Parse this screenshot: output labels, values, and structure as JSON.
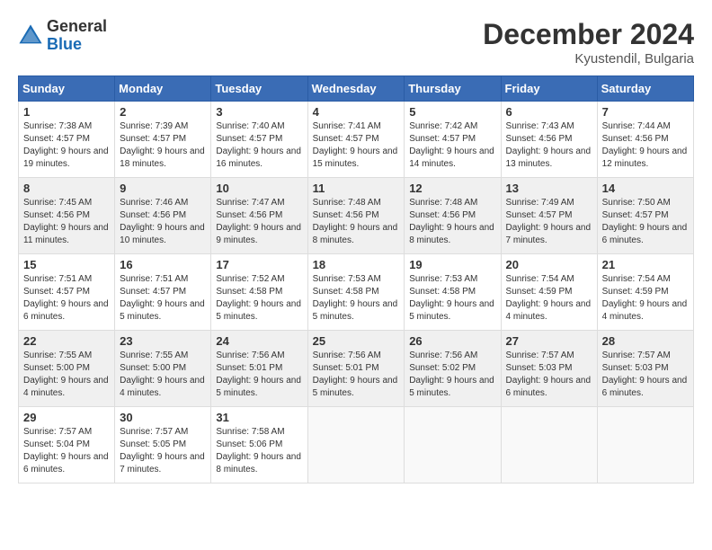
{
  "header": {
    "logo_general": "General",
    "logo_blue": "Blue",
    "month_year": "December 2024",
    "location": "Kyustendil, Bulgaria"
  },
  "weekdays": [
    "Sunday",
    "Monday",
    "Tuesday",
    "Wednesday",
    "Thursday",
    "Friday",
    "Saturday"
  ],
  "weeks": [
    [
      {
        "day": "1",
        "sunrise": "Sunrise: 7:38 AM",
        "sunset": "Sunset: 4:57 PM",
        "daylight": "Daylight: 9 hours and 19 minutes."
      },
      {
        "day": "2",
        "sunrise": "Sunrise: 7:39 AM",
        "sunset": "Sunset: 4:57 PM",
        "daylight": "Daylight: 9 hours and 18 minutes."
      },
      {
        "day": "3",
        "sunrise": "Sunrise: 7:40 AM",
        "sunset": "Sunset: 4:57 PM",
        "daylight": "Daylight: 9 hours and 16 minutes."
      },
      {
        "day": "4",
        "sunrise": "Sunrise: 7:41 AM",
        "sunset": "Sunset: 4:57 PM",
        "daylight": "Daylight: 9 hours and 15 minutes."
      },
      {
        "day": "5",
        "sunrise": "Sunrise: 7:42 AM",
        "sunset": "Sunset: 4:57 PM",
        "daylight": "Daylight: 9 hours and 14 minutes."
      },
      {
        "day": "6",
        "sunrise": "Sunrise: 7:43 AM",
        "sunset": "Sunset: 4:56 PM",
        "daylight": "Daylight: 9 hours and 13 minutes."
      },
      {
        "day": "7",
        "sunrise": "Sunrise: 7:44 AM",
        "sunset": "Sunset: 4:56 PM",
        "daylight": "Daylight: 9 hours and 12 minutes."
      }
    ],
    [
      {
        "day": "8",
        "sunrise": "Sunrise: 7:45 AM",
        "sunset": "Sunset: 4:56 PM",
        "daylight": "Daylight: 9 hours and 11 minutes."
      },
      {
        "day": "9",
        "sunrise": "Sunrise: 7:46 AM",
        "sunset": "Sunset: 4:56 PM",
        "daylight": "Daylight: 9 hours and 10 minutes."
      },
      {
        "day": "10",
        "sunrise": "Sunrise: 7:47 AM",
        "sunset": "Sunset: 4:56 PM",
        "daylight": "Daylight: 9 hours and 9 minutes."
      },
      {
        "day": "11",
        "sunrise": "Sunrise: 7:48 AM",
        "sunset": "Sunset: 4:56 PM",
        "daylight": "Daylight: 9 hours and 8 minutes."
      },
      {
        "day": "12",
        "sunrise": "Sunrise: 7:48 AM",
        "sunset": "Sunset: 4:56 PM",
        "daylight": "Daylight: 9 hours and 8 minutes."
      },
      {
        "day": "13",
        "sunrise": "Sunrise: 7:49 AM",
        "sunset": "Sunset: 4:57 PM",
        "daylight": "Daylight: 9 hours and 7 minutes."
      },
      {
        "day": "14",
        "sunrise": "Sunrise: 7:50 AM",
        "sunset": "Sunset: 4:57 PM",
        "daylight": "Daylight: 9 hours and 6 minutes."
      }
    ],
    [
      {
        "day": "15",
        "sunrise": "Sunrise: 7:51 AM",
        "sunset": "Sunset: 4:57 PM",
        "daylight": "Daylight: 9 hours and 6 minutes."
      },
      {
        "day": "16",
        "sunrise": "Sunrise: 7:51 AM",
        "sunset": "Sunset: 4:57 PM",
        "daylight": "Daylight: 9 hours and 5 minutes."
      },
      {
        "day": "17",
        "sunrise": "Sunrise: 7:52 AM",
        "sunset": "Sunset: 4:58 PM",
        "daylight": "Daylight: 9 hours and 5 minutes."
      },
      {
        "day": "18",
        "sunrise": "Sunrise: 7:53 AM",
        "sunset": "Sunset: 4:58 PM",
        "daylight": "Daylight: 9 hours and 5 minutes."
      },
      {
        "day": "19",
        "sunrise": "Sunrise: 7:53 AM",
        "sunset": "Sunset: 4:58 PM",
        "daylight": "Daylight: 9 hours and 5 minutes."
      },
      {
        "day": "20",
        "sunrise": "Sunrise: 7:54 AM",
        "sunset": "Sunset: 4:59 PM",
        "daylight": "Daylight: 9 hours and 4 minutes."
      },
      {
        "day": "21",
        "sunrise": "Sunrise: 7:54 AM",
        "sunset": "Sunset: 4:59 PM",
        "daylight": "Daylight: 9 hours and 4 minutes."
      }
    ],
    [
      {
        "day": "22",
        "sunrise": "Sunrise: 7:55 AM",
        "sunset": "Sunset: 5:00 PM",
        "daylight": "Daylight: 9 hours and 4 minutes."
      },
      {
        "day": "23",
        "sunrise": "Sunrise: 7:55 AM",
        "sunset": "Sunset: 5:00 PM",
        "daylight": "Daylight: 9 hours and 4 minutes."
      },
      {
        "day": "24",
        "sunrise": "Sunrise: 7:56 AM",
        "sunset": "Sunset: 5:01 PM",
        "daylight": "Daylight: 9 hours and 5 minutes."
      },
      {
        "day": "25",
        "sunrise": "Sunrise: 7:56 AM",
        "sunset": "Sunset: 5:01 PM",
        "daylight": "Daylight: 9 hours and 5 minutes."
      },
      {
        "day": "26",
        "sunrise": "Sunrise: 7:56 AM",
        "sunset": "Sunset: 5:02 PM",
        "daylight": "Daylight: 9 hours and 5 minutes."
      },
      {
        "day": "27",
        "sunrise": "Sunrise: 7:57 AM",
        "sunset": "Sunset: 5:03 PM",
        "daylight": "Daylight: 9 hours and 6 minutes."
      },
      {
        "day": "28",
        "sunrise": "Sunrise: 7:57 AM",
        "sunset": "Sunset: 5:03 PM",
        "daylight": "Daylight: 9 hours and 6 minutes."
      }
    ],
    [
      {
        "day": "29",
        "sunrise": "Sunrise: 7:57 AM",
        "sunset": "Sunset: 5:04 PM",
        "daylight": "Daylight: 9 hours and 6 minutes."
      },
      {
        "day": "30",
        "sunrise": "Sunrise: 7:57 AM",
        "sunset": "Sunset: 5:05 PM",
        "daylight": "Daylight: 9 hours and 7 minutes."
      },
      {
        "day": "31",
        "sunrise": "Sunrise: 7:58 AM",
        "sunset": "Sunset: 5:06 PM",
        "daylight": "Daylight: 9 hours and 8 minutes."
      },
      null,
      null,
      null,
      null
    ]
  ]
}
